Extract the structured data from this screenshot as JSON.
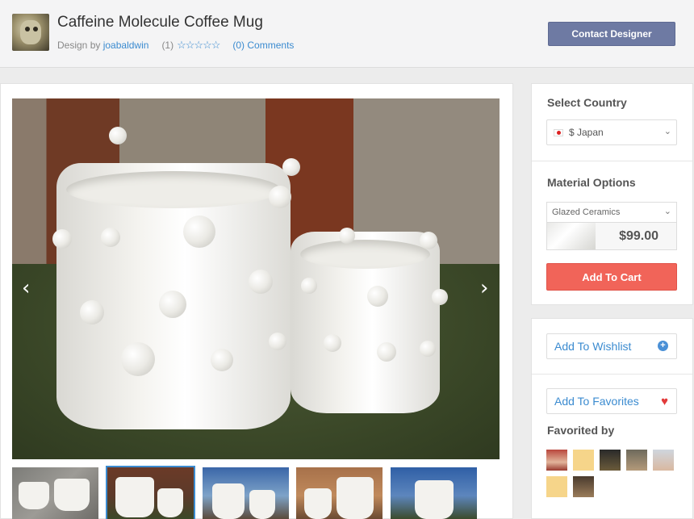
{
  "header": {
    "title": "Caffeine Molecule Coffee Mug",
    "design_by_prefix": "Design by",
    "designer": "joabaldwin",
    "rating_count": "(1)",
    "stars": "☆☆☆☆☆",
    "comments": "(0) Comments",
    "contact_button": "Contact Designer"
  },
  "gallery": {
    "prev_icon": "‹",
    "next_icon": "›",
    "active_thumb_index": 1,
    "thumb_count": 5
  },
  "purchase": {
    "country_label": "Select Country",
    "country_value": "$ Japan",
    "material_label": "Material Options",
    "material_value": "Glazed Ceramics",
    "price": "$99.00",
    "add_to_cart": "Add To Cart"
  },
  "social": {
    "wishlist": "Add To Wishlist",
    "favorites": "Add To Favorites",
    "favorited_by": "Favorited by",
    "avatar_count": 7
  },
  "colors": {
    "accent_blue": "#3b8bd0",
    "contact_button": "#6e7aa3",
    "cart_button": "#f16459",
    "heart": "#e23b3b"
  }
}
